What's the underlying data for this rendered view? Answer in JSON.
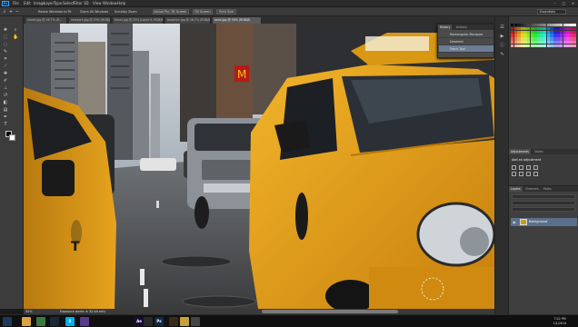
{
  "app": {
    "logo": "Ps"
  },
  "menu": [
    "File",
    "Edit",
    "Image",
    "Layer",
    "Type",
    "Select",
    "Filter",
    "3D",
    "View",
    "Window",
    "Help"
  ],
  "window_controls": [
    "–",
    "□",
    "✕"
  ],
  "options_bar": {
    "checks": [
      "Resize Windows to Fit",
      "Zoom All Windows",
      "Scrubby Zoom"
    ],
    "buttons": [
      "Actual Pixels",
      "Fit Screen",
      "Fill Screen",
      "Print Size"
    ],
    "workspace": "Essentials"
  },
  "tabs": [
    "street.jpg @ 16.7% (R...",
    "newyork.jpg @ 25% (RGB/8)",
    "times.jpg @ 25% (Layer 0, RGB/8)",
    "brooklyn.jpg @ 16.7% (RGB/8)",
    "taxis.jpg @ 50% (RGB/8)"
  ],
  "history": {
    "tabs": [
      "History",
      "Actions"
    ],
    "items": [
      "Rectangular Marquee",
      "Deselect",
      "Patch Tool"
    ]
  },
  "status": {
    "zoom": "50%",
    "info": "Exposure works in 32-bit only"
  },
  "right_panel": {
    "adjust_tabs": [
      "Adjustments",
      "Styles"
    ],
    "adjust_title": "Add an adjustment",
    "layer_tabs": [
      "Layers",
      "Channels",
      "Paths"
    ],
    "layer_name": "Background"
  },
  "taskbar": {
    "icons": [
      {
        "name": "start-icon",
        "label": "",
        "color": "#1e3a5a"
      },
      {
        "name": "explorer-icon",
        "label": "",
        "color": "#d9a441"
      },
      {
        "name": "chrome-icon",
        "label": "",
        "color": "#3a7a3a"
      },
      {
        "name": "steam-icon",
        "label": "",
        "color": "#1b2838"
      },
      {
        "name": "skype-icon",
        "label": "S",
        "color": "#00aff0"
      },
      {
        "name": "itunes-icon",
        "label": "",
        "color": "#5a3a8a"
      },
      {
        "name": "after-effects-icon",
        "label": "Ae",
        "color": "#1a0a3a"
      },
      {
        "name": "dreamweaver-icon",
        "label": "",
        "color": "#2a2a2a"
      },
      {
        "name": "photoshop-icon",
        "label": "Ps",
        "color": "#0d2a4a"
      },
      {
        "name": "bridge-icon",
        "label": "",
        "color": "#3a2a1a"
      },
      {
        "name": "folder-icon",
        "label": "",
        "color": "#c8a040"
      },
      {
        "name": "media-icon",
        "label": "",
        "color": "#444"
      }
    ],
    "clock_time": "7:22 PM",
    "clock_date": "1/1/2014"
  },
  "colors": {
    "taxi": "#e8a317",
    "ui_dark": "#2b2b2b",
    "ui_mid": "#3a3a3a",
    "accent": "#31a8ff"
  }
}
